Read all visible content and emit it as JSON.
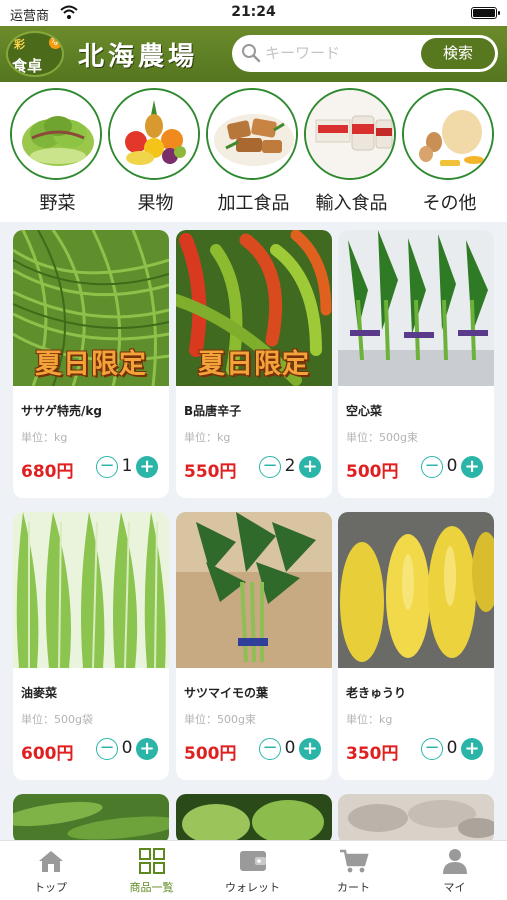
{
  "status_bar": {
    "carrier": "运营商",
    "time": "21:24"
  },
  "header": {
    "logo_top": "彩",
    "logo_bottom": "食卓",
    "logo_badge": "な",
    "brand": "北海農場",
    "search_placeholder": "キーワード",
    "search_button": "検索"
  },
  "categories": [
    {
      "label": "野菜",
      "icon": "lettuce-image"
    },
    {
      "label": "果物",
      "icon": "fruit-basket-image"
    },
    {
      "label": "加工食品",
      "icon": "processed-food-image"
    },
    {
      "label": "輸入食品",
      "icon": "imported-food-image"
    },
    {
      "label": "その他",
      "icon": "other-food-image"
    }
  ],
  "products": [
    {
      "name": "ササゲ特売/kg",
      "unit": "単位：kg",
      "price": "680円",
      "qty": "1",
      "promo": "夏日限定",
      "image": "long-beans-image"
    },
    {
      "name": "B品唐辛子",
      "unit": "単位：kg",
      "price": "550円",
      "qty": "2",
      "promo": "夏日限定",
      "image": "peppers-image"
    },
    {
      "name": "空心菜",
      "unit": "単位：500g束",
      "price": "500円",
      "qty": "0",
      "promo": "",
      "image": "water-spinach-image"
    },
    {
      "name": "油麥菜",
      "unit": "単位：500g袋",
      "price": "600円",
      "qty": "0",
      "promo": "",
      "image": "lettuce-leaves-image"
    },
    {
      "name": "サツマイモの葉",
      "unit": "単位：500g束",
      "price": "500円",
      "qty": "0",
      "promo": "",
      "image": "sweet-potato-leaves-image"
    },
    {
      "name": "老きゅうり",
      "unit": "単位：kg",
      "price": "350円",
      "qty": "0",
      "promo": "",
      "image": "yellow-cucumber-image"
    }
  ],
  "tabs": [
    {
      "label": "トップ",
      "icon": "home-icon"
    },
    {
      "label": "商品一覧",
      "icon": "grid-icon",
      "active": true
    },
    {
      "label": "ウォレット",
      "icon": "wallet-icon"
    },
    {
      "label": "カート",
      "icon": "cart-icon"
    },
    {
      "label": "マイ",
      "icon": "profile-icon"
    }
  ],
  "colors": {
    "header": "#5a7a22",
    "accent": "#2bb5a8",
    "price": "#e02020",
    "active_tab": "#5d8a1e"
  }
}
